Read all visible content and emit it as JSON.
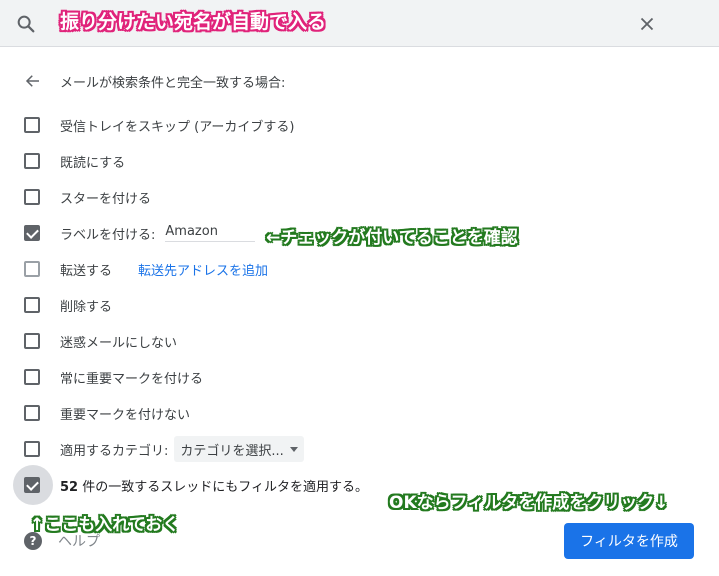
{
  "search": {
    "annotation": "振り分けたい宛名が自動で入る"
  },
  "header": {
    "text": "メールが検索条件と完全一致する場合:"
  },
  "options": [
    {
      "label": "受信トレイをスキップ (アーカイブする)",
      "checked": false
    },
    {
      "label": "既読にする",
      "checked": false
    },
    {
      "label": "スターを付ける",
      "checked": false
    },
    {
      "label": "ラベルを付ける:",
      "checked": true,
      "value": "Amazon"
    },
    {
      "label": "転送する",
      "checked": false,
      "link": "転送先アドレスを追加"
    },
    {
      "label": "削除する",
      "checked": false
    },
    {
      "label": "迷惑メールにしない",
      "checked": false
    },
    {
      "label": "常に重要マークを付ける",
      "checked": false
    },
    {
      "label": "重要マークを付けない",
      "checked": false
    },
    {
      "label": "適用するカテゴリ:",
      "checked": false,
      "select": "カテゴリを選択..."
    }
  ],
  "apply": {
    "count": "52",
    "text": " 件の一致するスレッドにもフィルタを適用する。",
    "checked": true
  },
  "annotations": {
    "label_check": "←チェックが付いてることを確認",
    "apply_check": "↑ここも入れておく",
    "create_hint": "OKならフィルタを作成をクリック↓"
  },
  "footer": {
    "help": "ヘルプ",
    "create_button": "フィルタを作成"
  },
  "colors": {
    "primary_blue": "#1a73e8",
    "annotation_pink": "#e0237a",
    "annotation_green": "#237a1f"
  }
}
